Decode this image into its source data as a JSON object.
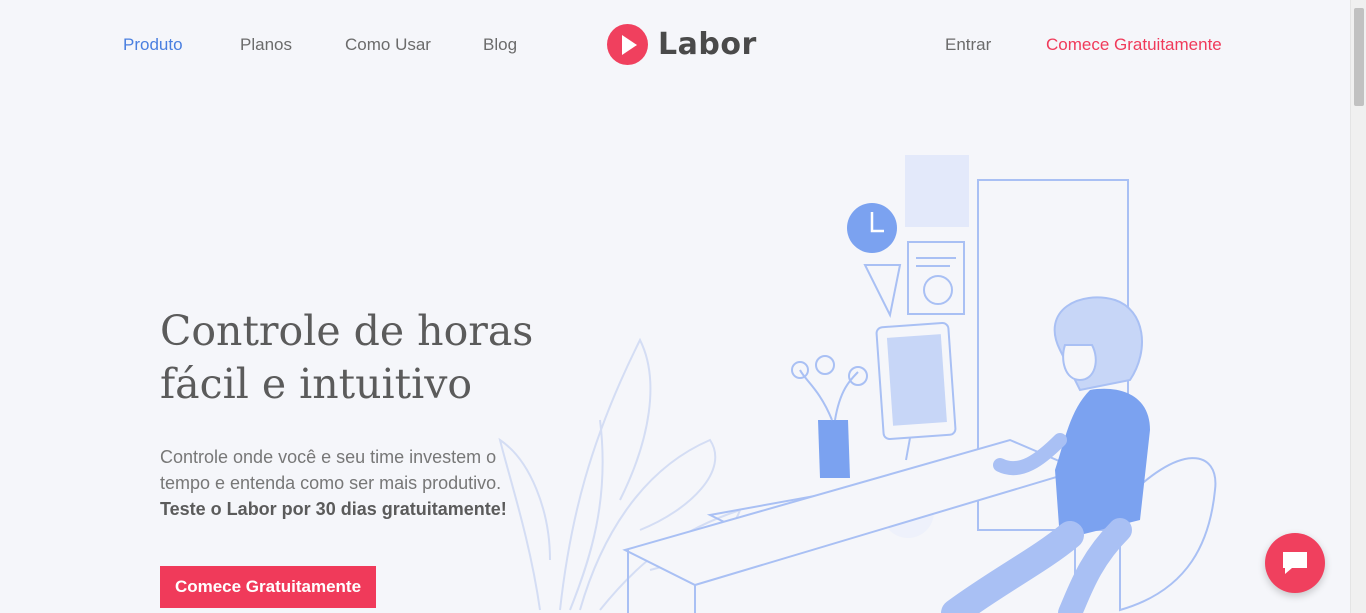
{
  "nav": {
    "left_links": [
      "Produto",
      "Planos",
      "Como Usar",
      "Blog"
    ],
    "brand": "Labor",
    "login": "Entrar",
    "cta": "Comece Gratuitamente"
  },
  "hero": {
    "title_line1": "Controle de horas",
    "title_line2": "fácil e intuitivo",
    "desc_line1": "Controle onde você e seu time investem o",
    "desc_line2": "tempo e entenda como ser mais produtivo.",
    "desc_bold": "Teste o Labor por 30 dias gratuitamente!",
    "button": "Comece Gratuitamente"
  },
  "colors": {
    "accent": "#f03a5a",
    "active_link": "#4a7fe0",
    "illustration_blue": "#7ba2f0",
    "background": "#f5f6fa"
  },
  "icons": {
    "logo": "play-circle-icon",
    "chat": "chat-bubble-icon"
  }
}
